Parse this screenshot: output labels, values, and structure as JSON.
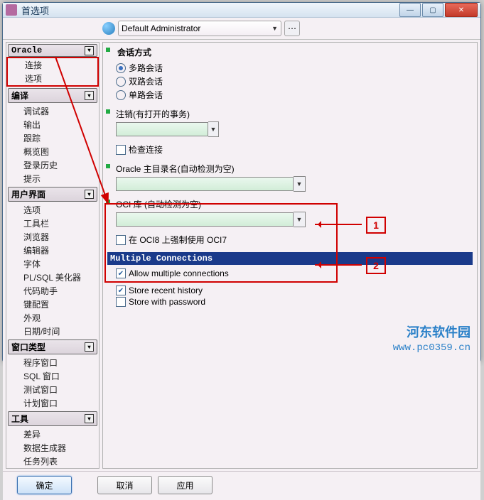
{
  "window": {
    "title": "首选项"
  },
  "topbar": {
    "admin": "Default Administrator"
  },
  "sidebar": {
    "groups": [
      {
        "title": "Oracle",
        "box_items": [
          "连接",
          "选项"
        ],
        "items": []
      },
      {
        "title": "编译",
        "items": [
          "调试器",
          "输出",
          "跟踪",
          "概览图",
          "登录历史",
          "提示"
        ]
      },
      {
        "title": "用户界面",
        "items": [
          "选项",
          "工具栏",
          "浏览器",
          "编辑器",
          "字体",
          "PL/SQL 美化器",
          "代码助手",
          "键配置",
          "外观",
          "日期/时间"
        ]
      },
      {
        "title": "窗口类型",
        "items": [
          "程序窗口",
          "SQL 窗口",
          "测试窗口",
          "计划窗口"
        ]
      },
      {
        "title": "工具",
        "items": [
          "差异",
          "数据生成器",
          "任务列表"
        ]
      }
    ]
  },
  "session": {
    "title": "会话方式",
    "opts": [
      "多路会话",
      "双路会话",
      "单路会话"
    ],
    "selected": 0
  },
  "logoff": {
    "label": "注销(有打开的事务)"
  },
  "checkconn": {
    "label": "检查连接"
  },
  "oracleHome": {
    "label": "Oracle 主目录名(自动检测为空)"
  },
  "ociLib": {
    "label": "OCI 库 (自动检测为空)"
  },
  "forceOci7": {
    "label": "在 OCI8 上强制使用 OCI7"
  },
  "multi": {
    "header": "Multiple Connections",
    "allow": "Allow multiple connections",
    "recent": "Store recent history",
    "storepw": "Store with password"
  },
  "callouts": {
    "one": "1",
    "two": "2"
  },
  "buttons": {
    "ok": "确定",
    "cancel": "取消",
    "apply": "应用"
  },
  "watermark": {
    "name": "河东软件园",
    "url": "www.pc0359.cn"
  }
}
